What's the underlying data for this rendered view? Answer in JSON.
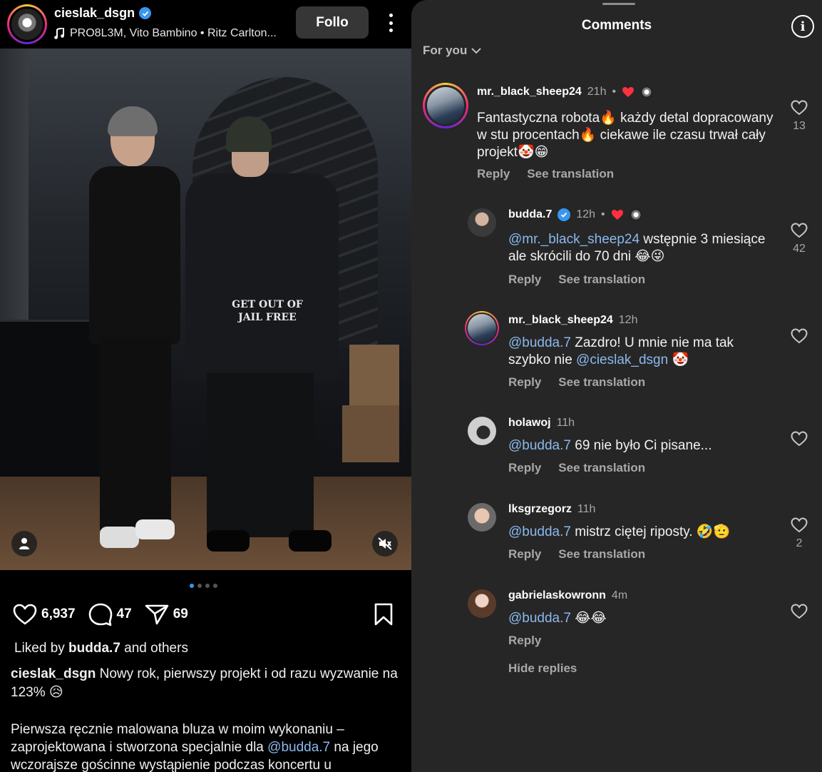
{
  "post": {
    "username": "cieslak_dsgn",
    "music": "PRO8L3M, Vito Bambino • Ritz Carlton...",
    "follow_label": "Follo",
    "shirt_text": "GET OUT OF JAIL FREE",
    "likes": "6,937",
    "comments_count": "47",
    "shares": "69",
    "liked_by_prefix": "Liked by ",
    "liked_by_user": "budda.7",
    "liked_by_suffix": " and others",
    "caption_user": "cieslak_dsgn",
    "caption_text": " Nowy rok, pierwszy projekt i od razu wyzwanie na 123% 😥",
    "caption2_part1": "Pierwsza ręcznie malowana bluza w moim wykonaniu – zaprojektowana i stworzona specjalnie dla ",
    "caption2_mention": "@budda.7",
    "caption2_part2": " na jego wczorajsze gościnne wystąpienie podczas koncertu u"
  },
  "comments_panel": {
    "title": "Comments",
    "filter": "For you",
    "reply_label": "Reply",
    "translation_label": "See translation",
    "hide_replies": "Hide replies",
    "comments": [
      {
        "user": "mr._black_sheep24",
        "time": "21h",
        "text": "Fantastyczna robota🔥 każdy detal dopracowany w stu procentach🔥 ciekawe ile czasu trwał cały projekt🤡😁",
        "likes": "13"
      },
      {
        "user": "budda.7",
        "time": "12h",
        "mention": "@mr._black_sheep24",
        "text": " wstępnie 3 miesiące ale skrócili do 70 dni 😂😜",
        "likes": "42"
      },
      {
        "user": "mr._black_sheep24",
        "time": "12h",
        "mention": "@budda.7",
        "text_a": " Zazdro! U mnie nie ma tak szybko nie ",
        "mention2": "@cieslak_dsgn",
        "text_b": " 🤡",
        "likes": ""
      },
      {
        "user": "holawoj",
        "time": "11h",
        "mention": "@budda.7",
        "text": " 69 nie było Ci pisane...",
        "likes": ""
      },
      {
        "user": "lksgrzegorz",
        "time": "11h",
        "mention": "@budda.7",
        "text": " mistrz ciętej riposty. 🤣🫡",
        "likes": "2"
      },
      {
        "user": "gabrielaskowronn",
        "time": "4m",
        "mention": "@budda.7",
        "text": " 😂😂",
        "likes": ""
      }
    ]
  },
  "colors": {
    "accent_blue": "#3897f0",
    "mention": "#8bb8ee",
    "heart_red": "#ff3040",
    "panel_bg": "#262626"
  }
}
